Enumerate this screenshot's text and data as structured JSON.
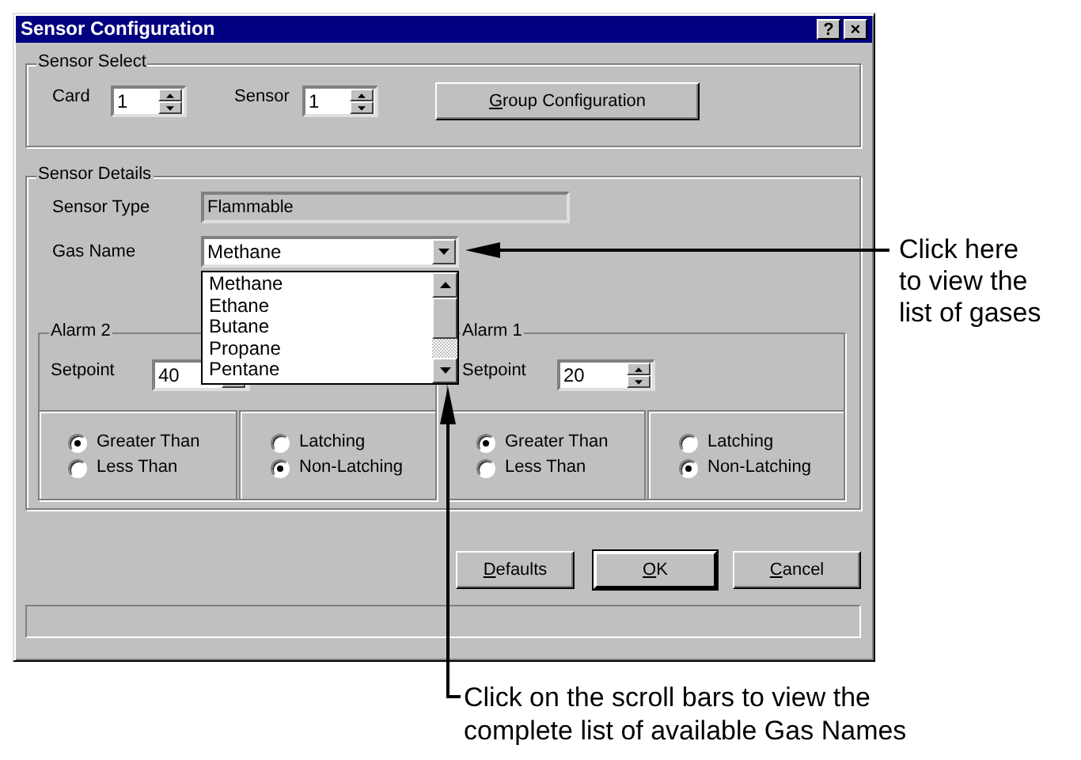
{
  "window": {
    "title": "Sensor Configuration",
    "title_buttons": [
      "?",
      "×"
    ]
  },
  "sensor_select": {
    "title": "Sensor Select",
    "card": {
      "label": "Card",
      "value": "1"
    },
    "sensor": {
      "label": "Sensor",
      "value": "1"
    },
    "group_button": {
      "label": "Group Configuration",
      "mnemonic": true
    }
  },
  "sensor_details": {
    "title": "Sensor Details",
    "sensor_type": {
      "label": "Sensor Type",
      "value": "Flammable",
      "disabled": true
    },
    "gas_name": {
      "label": "Gas Name",
      "value": "Methane",
      "expanded": true
    },
    "gas_list": [
      {
        "label": "Methane",
        "selected": false
      },
      {
        "label": "Ethane",
        "selected": false
      },
      {
        "label": "Butane",
        "selected": false
      },
      {
        "label": "Propane",
        "selected": false
      },
      {
        "label": "Pentane",
        "selected": false
      }
    ]
  },
  "alarms": [
    {
      "title": "Alarm 2",
      "setpoint_label": "Setpoint",
      "setpoint": "40",
      "comparison": [
        {
          "label": "Greater Than",
          "selected": true
        },
        {
          "label": "Less Than",
          "selected": false
        }
      ],
      "latching": [
        {
          "label": "Latching",
          "selected": false
        },
        {
          "label": "Non-Latching",
          "selected": true
        }
      ]
    },
    {
      "title": "Alarm 1",
      "setpoint_label": "Setpoint",
      "setpoint": "20",
      "comparison": [
        {
          "label": "Greater Than",
          "selected": true
        },
        {
          "label": "Less Than",
          "selected": false
        }
      ],
      "latching": [
        {
          "label": "Latching",
          "selected": false
        },
        {
          "label": "Non-Latching",
          "selected": true
        }
      ]
    }
  ],
  "buttons": [
    {
      "label": "Defaults",
      "default": false,
      "mnemonic": true
    },
    {
      "label": "OK",
      "default": true,
      "mnemonic": true
    },
    {
      "label": "Cancel",
      "default": false,
      "mnemonic": true
    }
  ],
  "annotations": [
    {
      "kind": "right",
      "lines": [
        "Click here",
        "to view the",
        "list of gases"
      ]
    },
    {
      "kind": "below",
      "lines": [
        "Click on the scroll bars to view the",
        "complete list of available Gas Names"
      ]
    }
  ]
}
